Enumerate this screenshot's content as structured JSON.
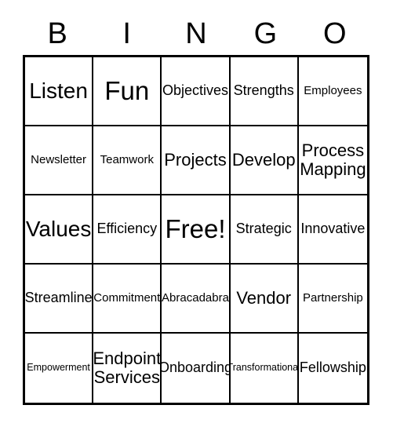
{
  "card": {
    "header_letters": [
      "B",
      "I",
      "N",
      "G",
      "O"
    ],
    "free_space_label": "Free!",
    "rows": [
      [
        {
          "label": "Listen",
          "size": "xl"
        },
        {
          "label": "Fun",
          "size": "xxl"
        },
        {
          "label": "Objectives",
          "size": "md"
        },
        {
          "label": "Strengths",
          "size": "md"
        },
        {
          "label": "Employees",
          "size": "sm"
        }
      ],
      [
        {
          "label": "Newsletter",
          "size": "sm"
        },
        {
          "label": "Teamwork",
          "size": "sm"
        },
        {
          "label": "Projects",
          "size": "lg"
        },
        {
          "label": "Develop",
          "size": "lg"
        },
        {
          "label": "Process Mapping",
          "size": "lg"
        }
      ],
      [
        {
          "label": "Values",
          "size": "xl"
        },
        {
          "label": "Efficiency",
          "size": "md"
        },
        {
          "label": "Free!",
          "size": "xxl"
        },
        {
          "label": "Strategic",
          "size": "md"
        },
        {
          "label": "Innovative",
          "size": "md"
        }
      ],
      [
        {
          "label": "Streamline",
          "size": "md"
        },
        {
          "label": "Commitment",
          "size": "sm"
        },
        {
          "label": "Abracadabra",
          "size": "sm"
        },
        {
          "label": "Vendor",
          "size": "lg"
        },
        {
          "label": "Partnership",
          "size": "sm"
        }
      ],
      [
        {
          "label": "Empowerment",
          "size": "xs"
        },
        {
          "label": "Endpoint Services",
          "size": "lg"
        },
        {
          "label": "Onboarding",
          "size": "md"
        },
        {
          "label": "Transformational",
          "size": "xs"
        },
        {
          "label": "Fellowship",
          "size": "md"
        }
      ]
    ]
  },
  "colors": {
    "ink": "#000000",
    "paper": "#ffffff"
  }
}
